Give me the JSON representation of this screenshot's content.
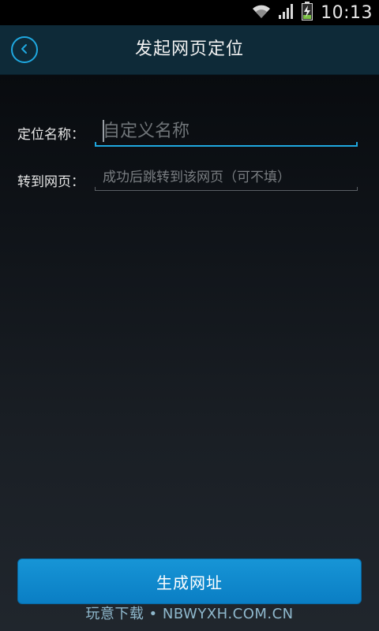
{
  "status_bar": {
    "time": "10:13",
    "icons": [
      "wifi-icon",
      "signal-icon",
      "battery-charging-icon"
    ]
  },
  "header": {
    "title": "发起网页定位",
    "back_icon": "chevron-left-icon"
  },
  "form": {
    "name": {
      "label": "定位名称：",
      "value": "",
      "placeholder": "自定义名称"
    },
    "page": {
      "label": "转到网页：",
      "value": "",
      "placeholder": "成功后跳转到该网页（可不填）"
    }
  },
  "actions": {
    "generate_label": "生成网址"
  },
  "watermark": "玩意下载 • NBWYXH.COM.CN",
  "colors": {
    "accent": "#1fa8e0",
    "header_bg": "#0e2a38",
    "button_bg": "#0a7ec4"
  }
}
